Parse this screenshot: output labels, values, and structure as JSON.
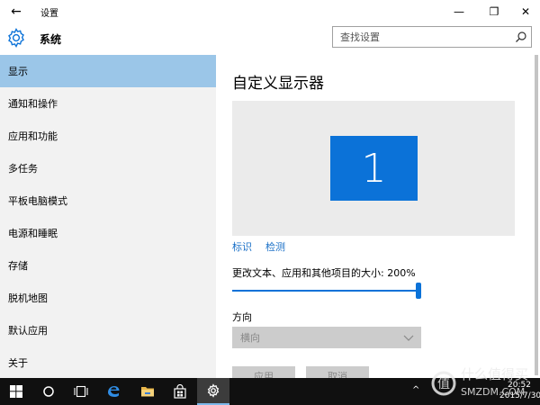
{
  "window": {
    "back_glyph": "←",
    "title": "设置",
    "minimize_glyph": "—",
    "maximize_glyph": "❐",
    "close_glyph": "✕"
  },
  "header": {
    "title": "系统",
    "icon": "gear-icon",
    "search_placeholder": "查找设置",
    "search_icon": "search-icon"
  },
  "sidebar": {
    "items": [
      {
        "label": "显示",
        "active": true
      },
      {
        "label": "通知和操作",
        "active": false
      },
      {
        "label": "应用和功能",
        "active": false
      },
      {
        "label": "多任务",
        "active": false
      },
      {
        "label": "平板电脑模式",
        "active": false
      },
      {
        "label": "电源和睡眠",
        "active": false
      },
      {
        "label": "存储",
        "active": false
      },
      {
        "label": "脱机地图",
        "active": false
      },
      {
        "label": "默认应用",
        "active": false
      },
      {
        "label": "关于",
        "active": false
      }
    ]
  },
  "main": {
    "title": "自定义显示器",
    "monitor_number": "1",
    "identify_link": "标识",
    "detect_link": "检测",
    "scale_label": "更改文本、应用和其他项目的大小: 200%",
    "scale_slider_value_fraction": 1.0,
    "orientation_label": "方向",
    "orientation_value": "横向",
    "apply_button": "应用",
    "cancel_button": "取消"
  },
  "taskbar": {
    "icons": [
      "windows-start-icon",
      "cortana-icon",
      "task-view-icon",
      "edge-icon",
      "file-explorer-icon",
      "store-icon",
      "settings-icon"
    ],
    "tray_up_glyph": "^",
    "time": "20:52",
    "date": "2015/7/30"
  },
  "watermark": {
    "line1": "什么值得买",
    "line2": "SMZDM.COM"
  },
  "colors": {
    "accent": "#0b72d8",
    "sidebar_bg": "#f2f2f2",
    "sidebar_active": "#9bc6e8",
    "link": "#1a70c7",
    "taskbar": "#101010"
  }
}
